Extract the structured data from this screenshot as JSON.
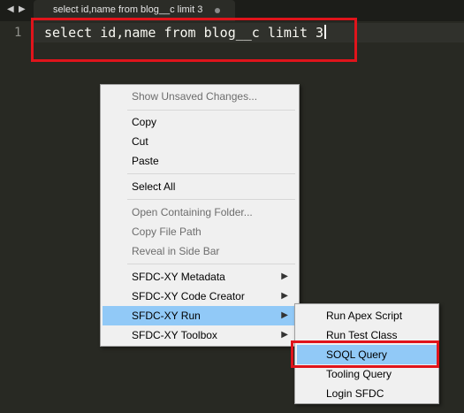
{
  "tab": {
    "title": "select id,name from blog__c limit 3"
  },
  "editor": {
    "line_number": "1",
    "code": "select id,name from blog__c limit 3"
  },
  "context_menu": {
    "items": [
      {
        "label": "Show Unsaved Changes...",
        "enabled": false
      },
      {
        "label": "Copy",
        "enabled": true
      },
      {
        "label": "Cut",
        "enabled": true
      },
      {
        "label": "Paste",
        "enabled": true
      },
      {
        "label": "Select All",
        "enabled": true
      },
      {
        "label": "Open Containing Folder...",
        "enabled": false
      },
      {
        "label": "Copy File Path",
        "enabled": false
      },
      {
        "label": "Reveal in Side Bar",
        "enabled": false
      },
      {
        "label": "SFDC-XY Metadata",
        "enabled": true,
        "submenu": true
      },
      {
        "label": "SFDC-XY Code Creator",
        "enabled": true,
        "submenu": true
      },
      {
        "label": "SFDC-XY Run",
        "enabled": true,
        "submenu": true,
        "active": true
      },
      {
        "label": "SFDC-XY Toolbox",
        "enabled": true,
        "submenu": true
      }
    ]
  },
  "submenu": {
    "items": [
      {
        "label": "Run Apex Script"
      },
      {
        "label": "Run Test Class"
      },
      {
        "label": "SOQL Query",
        "active": true
      },
      {
        "label": "Tooling Query"
      },
      {
        "label": "Login SFDC"
      }
    ]
  },
  "colors": {
    "editor_bg": "#282923",
    "highlight": "#91c9f7",
    "annotation": "#e0141b"
  }
}
